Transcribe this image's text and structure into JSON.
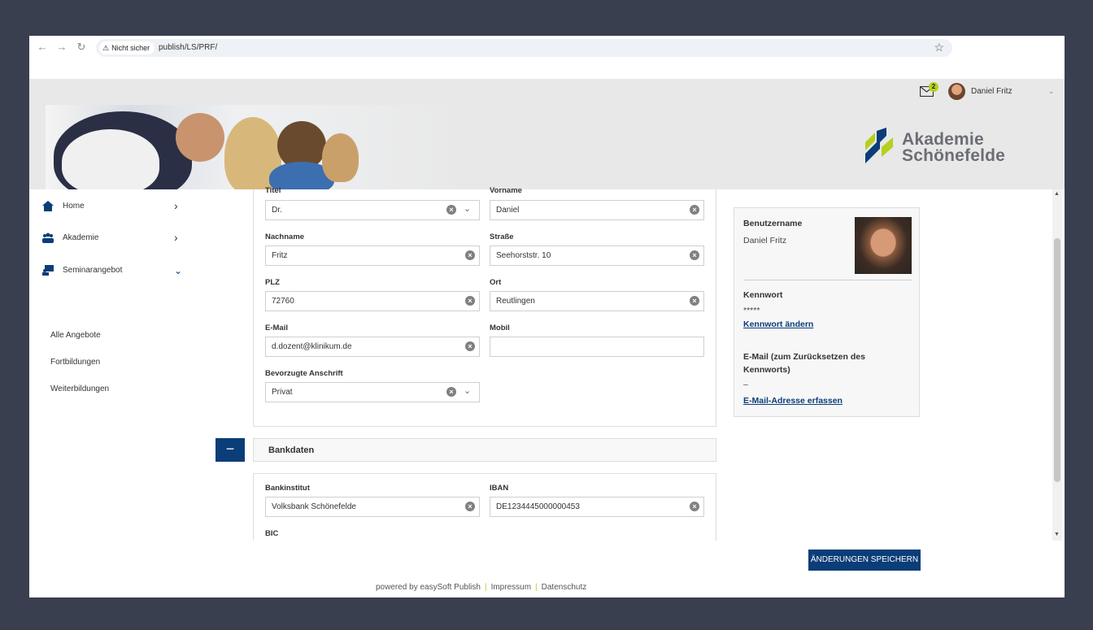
{
  "browser": {
    "security_label": "Nicht sicher",
    "url": "publish/LS/PRF/"
  },
  "header": {
    "mail_count": "2",
    "user_name": "Daniel Fritz",
    "logo_line1": "Akademie",
    "logo_line2": "Schönefelde"
  },
  "sidebar": {
    "items": [
      {
        "label": "Home",
        "icon": "home-icon"
      },
      {
        "label": "Akademie",
        "icon": "group-icon"
      },
      {
        "label": "Seminarangebot",
        "icon": "seminar-icon"
      }
    ],
    "sub_items": [
      {
        "label": "Alle Angebote"
      },
      {
        "label": "Fortbildungen"
      },
      {
        "label": "Weiterbildungen"
      }
    ]
  },
  "form": {
    "titel": {
      "label": "Titel",
      "value": "Dr."
    },
    "vorname": {
      "label": "Vorname",
      "value": "Daniel"
    },
    "nachname": {
      "label": "Nachname",
      "value": "Fritz"
    },
    "strasse": {
      "label": "Straße",
      "value": "Seehorststr. 10"
    },
    "plz": {
      "label": "PLZ",
      "value": "72760"
    },
    "ort": {
      "label": "Ort",
      "value": "Reutlingen"
    },
    "email": {
      "label": "E-Mail",
      "value": "d.dozent@klinikum.de"
    },
    "mobil": {
      "label": "Mobil",
      "value": ""
    },
    "anschrift": {
      "label": "Bevorzugte Anschrift",
      "value": "Privat"
    }
  },
  "bank": {
    "toggle": "−",
    "title": "Bankdaten",
    "institut": {
      "label": "Bankinstitut",
      "value": "Volksbank Schönefelde"
    },
    "iban": {
      "label": "IBAN",
      "value": "DE1234445000000453"
    },
    "bic": {
      "label": "BIC"
    }
  },
  "account": {
    "username_label": "Benutzername",
    "username": "Daniel Fritz",
    "password_label": "Kennwort",
    "password_mask": "*****",
    "password_link": "Kennwort ändern",
    "email_label": "E-Mail (zum Zurücksetzen des Kennworts)",
    "email_value": "–",
    "email_link": "E-Mail-Adresse erfassen"
  },
  "actions": {
    "save_label": "ÄNDERUNGEN SPEICHERN"
  },
  "footer": {
    "powered": "powered by easySoft Publish",
    "impressum": "Impressum",
    "datenschutz": "Datenschutz"
  },
  "colors": {
    "brand_blue": "#0b3d78",
    "accent_green": "#b6cf1e",
    "page_bg": "#3a3f50"
  }
}
